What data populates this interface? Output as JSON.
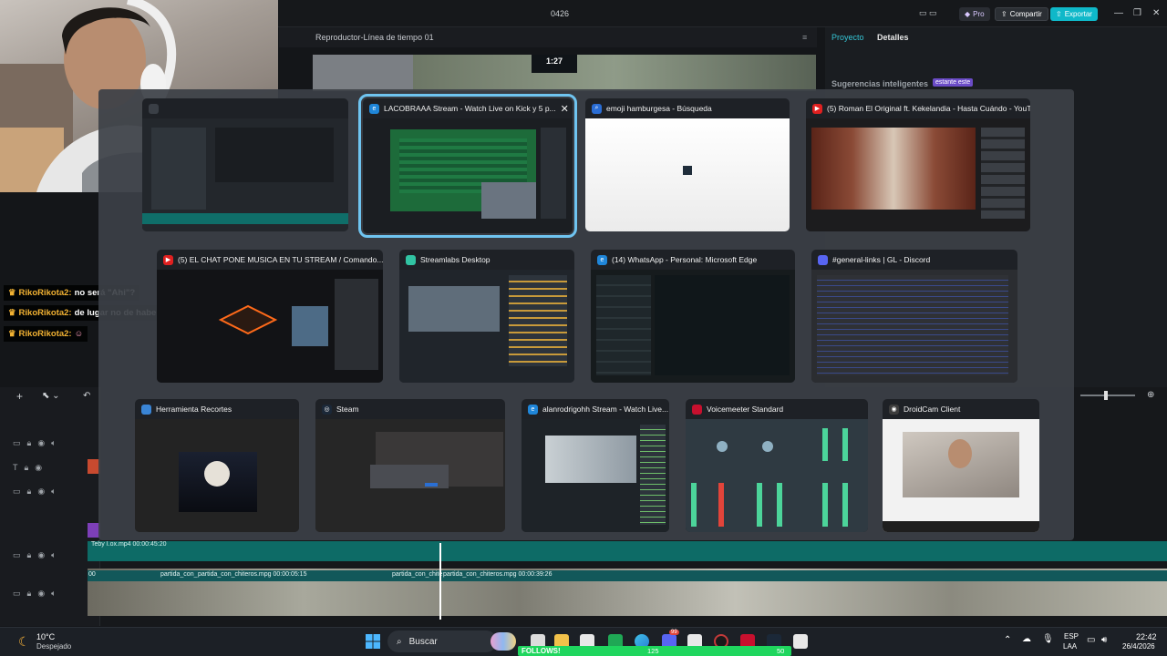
{
  "editor": {
    "doc_title": "0426",
    "pro_label": "Pro",
    "share_label": "Compartir",
    "export_label": "Exportar",
    "player_title": "Reproductor-Línea de tiempo 01",
    "tab_project": "Proyecto",
    "tab_details": "Detalles",
    "smart_suggestions": "Sugerencias inteligentes",
    "smart_badge": "estante este",
    "player_time": "1:27"
  },
  "chat": [
    {
      "user": "RikoRikota2:",
      "message": "no será \"Ahi\"?"
    },
    {
      "user": "RikoRikota2:",
      "message": "de lugar no de haber"
    },
    {
      "user": "RikoRikota2:",
      "message": ""
    }
  ],
  "alttab": {
    "row1": [
      {
        "title": "",
        "icon": "editor-icon",
        "color": "#2a2d33"
      },
      {
        "title": "LACOBRAAA Stream - Watch Live on Kick y 5 p...",
        "icon": "edge-icon",
        "color": "#1d6b3a",
        "selected": true
      },
      {
        "title": "emoji hamburgesa - Búsqueda",
        "icon": "search-icon",
        "color": "#f0f0f0"
      },
      {
        "title": "(5) Roman El Original ft. Kekelandia - Hasta Cuándo - YouT...",
        "icon": "youtube-icon",
        "color": "#5a2a20"
      }
    ],
    "row2": [
      {
        "title": "(5)   EL CHAT PONE MUSICA EN TU STREAM / Comando...",
        "icon": "youtube-icon",
        "color": "#1a1a1e"
      },
      {
        "title": "Streamlabs Desktop",
        "icon": "streamlabs-icon",
        "color": "#2b3138"
      },
      {
        "title": "(14) WhatsApp - Personal: Microsoft Edge",
        "icon": "edge-icon",
        "color": "#1c2420"
      },
      {
        "title": "#general-links | GL - Discord",
        "icon": "discord-icon",
        "color": "#2d2f36"
      }
    ],
    "row3": [
      {
        "title": "Herramienta Recortes",
        "icon": "snipping-tool-icon",
        "color": "#2a2a2a"
      },
      {
        "title": "Steam",
        "icon": "steam-icon",
        "color": "#2a2a2a"
      },
      {
        "title": "alanrodrigohh Stream - Watch Live...",
        "icon": "edge-icon",
        "color": "#2b3138"
      },
      {
        "title": "Voicemeeter Standard",
        "icon": "voicemeeter-icon",
        "color": "#2f3a42"
      },
      {
        "title": "DroidCam Client",
        "icon": "droidcam-icon",
        "color": "#e8e8e8"
      }
    ]
  },
  "timeline": {
    "track_label_1": "Teby I.ox.mp4   00:00:45:20",
    "clips": [
      {
        "label": "00"
      },
      {
        "label": "partida_con_"
      },
      {
        "label": "partida_con_chiteros.mpg   00:00:05:15"
      },
      {
        "label": "partida_con_chite"
      },
      {
        "label": "partida_con_chiteros.mpg   00:00:39:26"
      }
    ]
  },
  "taskbar": {
    "weather_temp": "10°C",
    "weather_desc": "Despejado",
    "search_placeholder": "Buscar",
    "lang_1": "ESP",
    "lang_2": "LAA",
    "time": "22:42",
    "date": "26/4/2026",
    "notif_badge": "99"
  },
  "follows": {
    "label": "FOLLOWS!",
    "current": "125",
    "goal": "50",
    "fill_fraction": 1.0
  }
}
